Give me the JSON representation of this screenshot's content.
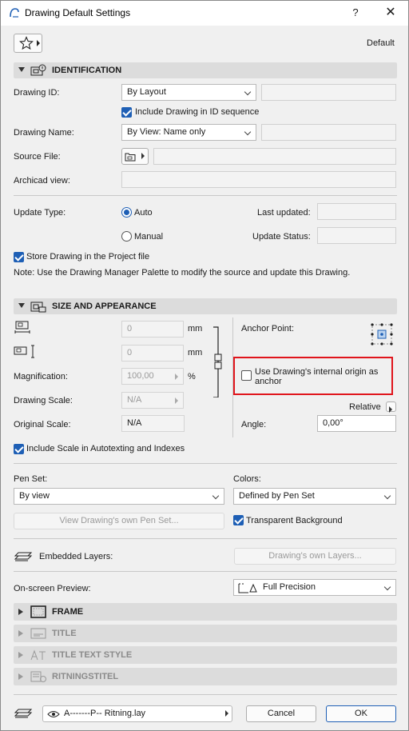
{
  "window": {
    "title": "Drawing Default Settings",
    "help": "?",
    "close": "✕"
  },
  "favorites": {
    "label": "Default"
  },
  "identification": {
    "header": "IDENTIFICATION",
    "drawing_id_label": "Drawing ID:",
    "drawing_id_value": "By Layout",
    "include_in_sequence": "Include Drawing in ID sequence",
    "drawing_name_label": "Drawing Name:",
    "drawing_name_value": "By View: Name only",
    "source_file_label": "Source File:",
    "archicad_view_label": "Archicad view:",
    "update_type_label": "Update Type:",
    "update_auto": "Auto",
    "update_manual": "Manual",
    "last_updated_label": "Last updated:",
    "update_status_label": "Update Status:",
    "store_in_project": "Store Drawing in the Project file",
    "note": "Note: Use the Drawing Manager Palette to modify the source and update this Drawing."
  },
  "size": {
    "header": "SIZE AND APPEARANCE",
    "width_value": "0",
    "height_value": "0",
    "unit_mm": "mm",
    "magnification_label": "Magnification:",
    "magnification_value": "100,00",
    "percent": "%",
    "drawing_scale_label": "Drawing Scale:",
    "drawing_scale_value": "N/A",
    "original_scale_label": "Original Scale:",
    "original_scale_value": "N/A",
    "anchor_point_label": "Anchor Point:",
    "use_internal_origin": "Use Drawing's internal origin as anchor",
    "relative_label": "Relative",
    "angle_label": "Angle:",
    "angle_value": "0,00°",
    "include_scale": "Include Scale in Autotexting and Indexes",
    "pen_set_label": "Pen Set:",
    "pen_set_value": "By view",
    "colors_label": "Colors:",
    "colors_value": "Defined by Pen Set",
    "view_pen_set_button": "View Drawing's own Pen Set...",
    "transparent_background": "Transparent Background",
    "embedded_layers_label": "Embedded Layers:",
    "own_layers_button": "Drawing's own Layers...",
    "preview_label": "On-screen Preview:",
    "preview_value": "Full Precision"
  },
  "sections": {
    "frame": "FRAME",
    "title": "TITLE",
    "title_text_style": "TITLE TEXT STYLE",
    "ritningstitel": "RITNINGSTITEL"
  },
  "footer": {
    "layer_value": "A-------P-- Ritning.lay",
    "cancel": "Cancel",
    "ok": "OK"
  },
  "colors": {
    "accent": "#1e5fb5",
    "highlight": "#e0151c"
  }
}
